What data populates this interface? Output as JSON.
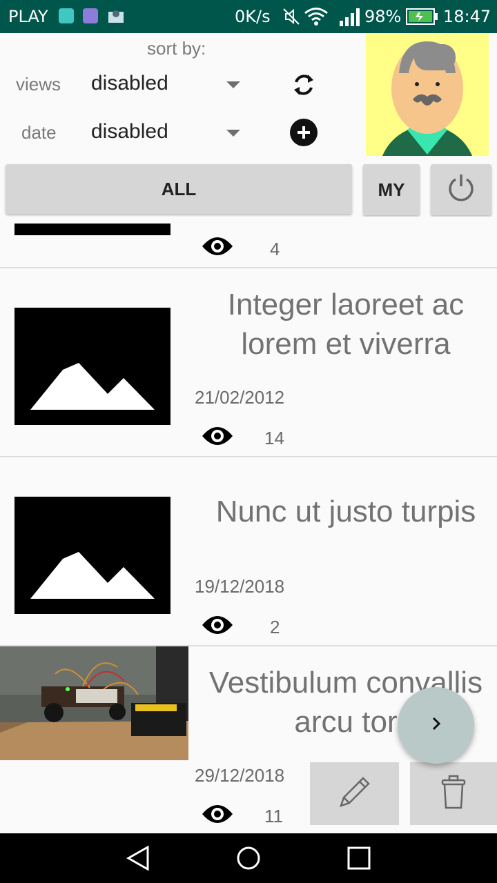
{
  "status_bar": {
    "carrier": "PLAY",
    "net_speed": "0K/s",
    "battery": "98%",
    "time": "18:47"
  },
  "sort": {
    "title": "sort by:",
    "rows": [
      {
        "label": "views",
        "value": "disabled"
      },
      {
        "label": "date",
        "value": "disabled"
      }
    ]
  },
  "filters": {
    "all_label": "ALL",
    "my_label": "MY"
  },
  "posts": [
    {
      "title": "",
      "date": "",
      "views": "4"
    },
    {
      "title": "Integer laoreet ac lorem et viverra",
      "date": "21/02/2012",
      "views": "14"
    },
    {
      "title": "Nunc ut justo turpis",
      "date": "19/12/2018",
      "views": "2"
    },
    {
      "title": "Vestibulum convallis arcu tor",
      "date": "29/12/2018",
      "views": "11"
    }
  ],
  "colors": {
    "status_bar": "#00564a",
    "button_bg": "#d6d6d6",
    "fab": "#b9c9c7",
    "avatar_bg": "#ffff88"
  },
  "icons": [
    "android-icon",
    "gallery-icon",
    "mail-icon",
    "mute-icon",
    "wifi-icon",
    "signal-icon",
    "battery-icon",
    "refresh-icon",
    "add-circle-icon",
    "power-icon",
    "eye-icon",
    "image-placeholder-icon",
    "chevron-right-icon",
    "pencil-icon",
    "trash-icon",
    "back-icon",
    "home-icon",
    "recents-icon"
  ]
}
